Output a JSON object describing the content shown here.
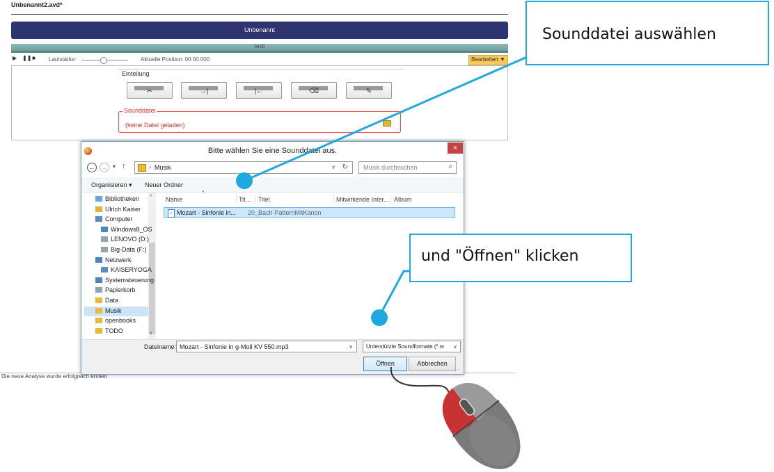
{
  "app": {
    "doc_title": "Unbenannt2.avd*",
    "header_title": "Unbenannt",
    "timeline_time": "00:00",
    "volume_label": "Lautstärke:",
    "position_label": "Aktuelle Position: 00:00.000",
    "edit_button": "Bearbeiten",
    "einteilung_label": "Einteilung",
    "sounddatei_label": "Sounddatei",
    "sounddatei_value": "(keine Datei geladen)",
    "status_text": "Die neue Analyse wurde erfolgreich erstellt"
  },
  "dialog": {
    "title": "Bitte wählen Sie eine Sounddatei aus.",
    "close_label": "×",
    "address": {
      "folder": "Musik"
    },
    "search_placeholder": "Musik durchsuchen",
    "commands": {
      "organize": "Organisieren ▾",
      "new_folder": "Neuer Ordner"
    },
    "tree": [
      {
        "label": "Bibliotheken",
        "icon": "library-icon",
        "color": "#6aa7d8"
      },
      {
        "label": "Ulrich Kaiser",
        "icon": "user-folder-icon",
        "color": "#e0b040"
      },
      {
        "label": "Computer",
        "icon": "computer-icon",
        "color": "#5b8bc7"
      },
      {
        "label": "Windows8_OS",
        "icon": "drive-icon",
        "color": "#4a86c5"
      },
      {
        "label": "LENOVO (D:)",
        "icon": "drive-icon",
        "color": "#9aa2aa"
      },
      {
        "label": "Big-Data (F:)",
        "icon": "drive-icon",
        "color": "#9aa2aa"
      },
      {
        "label": "Netzwerk",
        "icon": "network-icon",
        "color": "#4a86c5"
      },
      {
        "label": "KAISERYOGA",
        "icon": "network-computer-icon",
        "color": "#5b8bc7"
      },
      {
        "label": "Systemsteuerung",
        "icon": "control-panel-icon",
        "color": "#4a86c5"
      },
      {
        "label": "Papierkorb",
        "icon": "recycle-bin-icon",
        "color": "#8da3b8"
      },
      {
        "label": "Data",
        "icon": "folder-icon",
        "color": "#e9b939"
      },
      {
        "label": "Musik",
        "icon": "folder-icon",
        "color": "#e9b939"
      },
      {
        "label": "openbooks",
        "icon": "folder-icon",
        "color": "#e9b939"
      },
      {
        "label": "TODO",
        "icon": "folder-icon",
        "color": "#e9b939"
      }
    ],
    "columns": [
      "Name",
      "Tit...",
      "Titel",
      "Mitwirkende Inter...",
      "Album"
    ],
    "files": [
      {
        "name": "Mozart - Sinfonie in...",
        "title": "20_Bach-PatternMitKanon"
      }
    ],
    "filename_label": "Dateiname:",
    "filename_value": "Mozart - Sinfonie in g-Moll KV 550.mp3",
    "filetype_value": "Unterstützte Soundformate (*.w",
    "open_button": "Öffnen",
    "cancel_button": "Abbrechen"
  },
  "callouts": {
    "select_file": "Sounddatei auswählen",
    "click_open": "und \"Öffnen\" klicken"
  },
  "colors": {
    "header": "#2e3470",
    "accent": "#1fa8e0",
    "selection": "#cce8ff",
    "edit_button": "#f6c85a"
  }
}
